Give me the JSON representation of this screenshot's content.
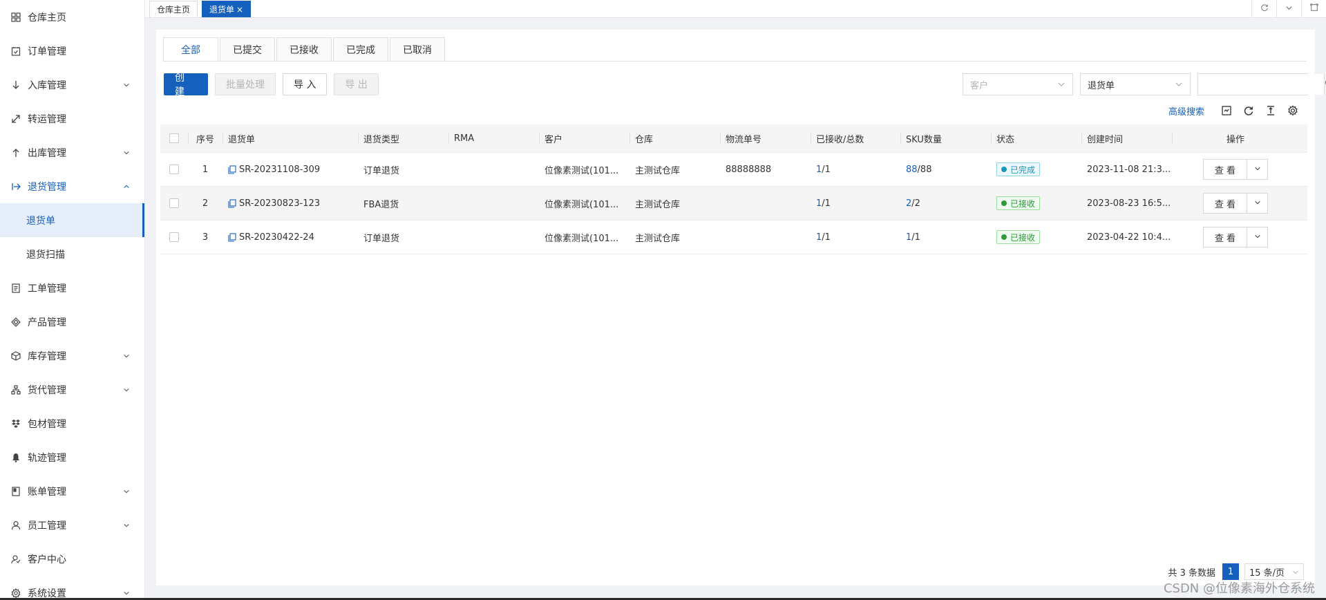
{
  "sidebar": {
    "items": [
      {
        "label": "仓库主页",
        "icon": "grid-icon",
        "chevron": false
      },
      {
        "label": "订单管理",
        "icon": "order-icon",
        "chevron": false
      },
      {
        "label": "入库管理",
        "icon": "arrow-down-icon",
        "chevron": true
      },
      {
        "label": "转运管理",
        "icon": "transfer-icon",
        "chevron": false
      },
      {
        "label": "出库管理",
        "icon": "arrow-up-icon",
        "chevron": true
      },
      {
        "label": "退货管理",
        "icon": "return-icon",
        "chevron": true,
        "open": true
      },
      {
        "label": "退货单",
        "sub": true,
        "active": true
      },
      {
        "label": "退货扫描",
        "sub": true
      },
      {
        "label": "工单管理",
        "icon": "ticket-icon",
        "chevron": false
      },
      {
        "label": "产品管理",
        "icon": "product-icon",
        "chevron": false
      },
      {
        "label": "库存管理",
        "icon": "box-icon",
        "chevron": true
      },
      {
        "label": "货代管理",
        "icon": "org-icon",
        "chevron": true
      },
      {
        "label": "包材管理",
        "icon": "package-icon",
        "chevron": false
      },
      {
        "label": "轨迹管理",
        "icon": "bell-icon",
        "chevron": false
      },
      {
        "label": "账单管理",
        "icon": "bill-icon",
        "chevron": true
      },
      {
        "label": "员工管理",
        "icon": "user-icon",
        "chevron": true
      },
      {
        "label": "客户中心",
        "icon": "customer-icon",
        "chevron": false
      },
      {
        "label": "系统设置",
        "icon": "gear-icon",
        "chevron": true
      }
    ]
  },
  "page_tabs": {
    "home": "仓库主页",
    "current": "退货单",
    "close": "×"
  },
  "status_tabs": [
    "全部",
    "已提交",
    "已接收",
    "已完成",
    "已取消"
  ],
  "toolbar": {
    "create": "创 建",
    "batch": "批量处理",
    "import": "导 入",
    "export": "导 出"
  },
  "filters": {
    "customer_placeholder": "客户",
    "doc_type": "退货单",
    "search_placeholder": ""
  },
  "tools": {
    "advanced_search": "高级搜索"
  },
  "table": {
    "headers": {
      "seq": "序号",
      "no": "退货单",
      "type": "退货类型",
      "rma": "RMA",
      "customer": "客户",
      "warehouse": "仓库",
      "tracking": "物流单号",
      "received": "已接收/总数",
      "sku": "SKU数量",
      "status": "状态",
      "created": "创建时间",
      "ops": "操作"
    },
    "rows": [
      {
        "seq": "1",
        "no": "SR-20231108-309",
        "type": "订单退货",
        "rma": "",
        "customer": "位像素测试(101...",
        "warehouse": "主测试仓库",
        "tracking": "88888888",
        "recv_a": "1",
        "recv_b": " /1",
        "sku_a": "88",
        "sku_b": " /88",
        "status": "已完成",
        "status_kind": "done",
        "created": "2023-11-08 21:3...",
        "view": "查 看"
      },
      {
        "seq": "2",
        "no": "SR-20230823-123",
        "type": "FBA退货",
        "rma": "",
        "customer": "位像素测试(101...",
        "warehouse": "主测试仓库",
        "tracking": "",
        "recv_a": "1",
        "recv_b": " /1",
        "sku_a": "2",
        "sku_b": " /2",
        "status": "已接收",
        "status_kind": "recv",
        "created": "2023-08-23 16:5...",
        "view": "查 看"
      },
      {
        "seq": "3",
        "no": "SR-20230422-24",
        "type": "订单退货",
        "rma": "",
        "customer": "位像素测试(101...",
        "warehouse": "主测试仓库",
        "tracking": "",
        "recv_a": "1",
        "recv_b": " /1",
        "sku_a": "1",
        "sku_b": " /1",
        "status": "已接收",
        "status_kind": "recv",
        "created": "2023-04-22 10:4...",
        "view": "查 看"
      }
    ]
  },
  "pagination": {
    "total": "共 3 条数据",
    "page": "1",
    "page_size": "15 条/页"
  },
  "watermark": "CSDN @位像素海外仓系统",
  "colors": {
    "primary": "#1560bd",
    "done": "#1896b8",
    "received": "#2e9a38"
  }
}
